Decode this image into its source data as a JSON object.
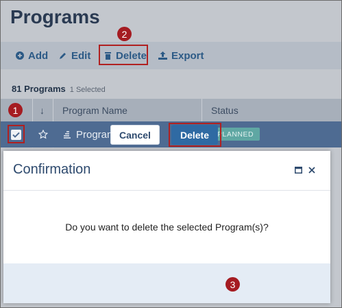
{
  "page": {
    "title": "Programs"
  },
  "toolbar": {
    "add_label": "Add",
    "edit_label": "Edit",
    "delete_label": "Delete",
    "export_label": "Export"
  },
  "summary": {
    "count_text": "81 Programs",
    "selected_text": "1 Selected"
  },
  "table": {
    "columns": {
      "sort": "↓",
      "name": "Program Name",
      "status": "Status"
    },
    "rows": [
      {
        "checked": true,
        "name": "Program 1",
        "status": "PLANNED"
      }
    ]
  },
  "dialog": {
    "title": "Confirmation",
    "message": "Do you want to delete the selected Program(s)?",
    "cancel_label": "Cancel",
    "delete_label": "Delete"
  },
  "annotations": {
    "step1": "1",
    "step2": "2",
    "step3": "3"
  },
  "icons": [
    "plus-circle-icon",
    "pencil-icon",
    "trash-icon",
    "upload-icon",
    "star-icon",
    "program-icon",
    "maximize-icon",
    "close-icon",
    "checkmark-icon"
  ],
  "colors": {
    "highlight": "#b02020",
    "primary": "#2f6aa3",
    "status_badge": "#5fa7a3"
  }
}
